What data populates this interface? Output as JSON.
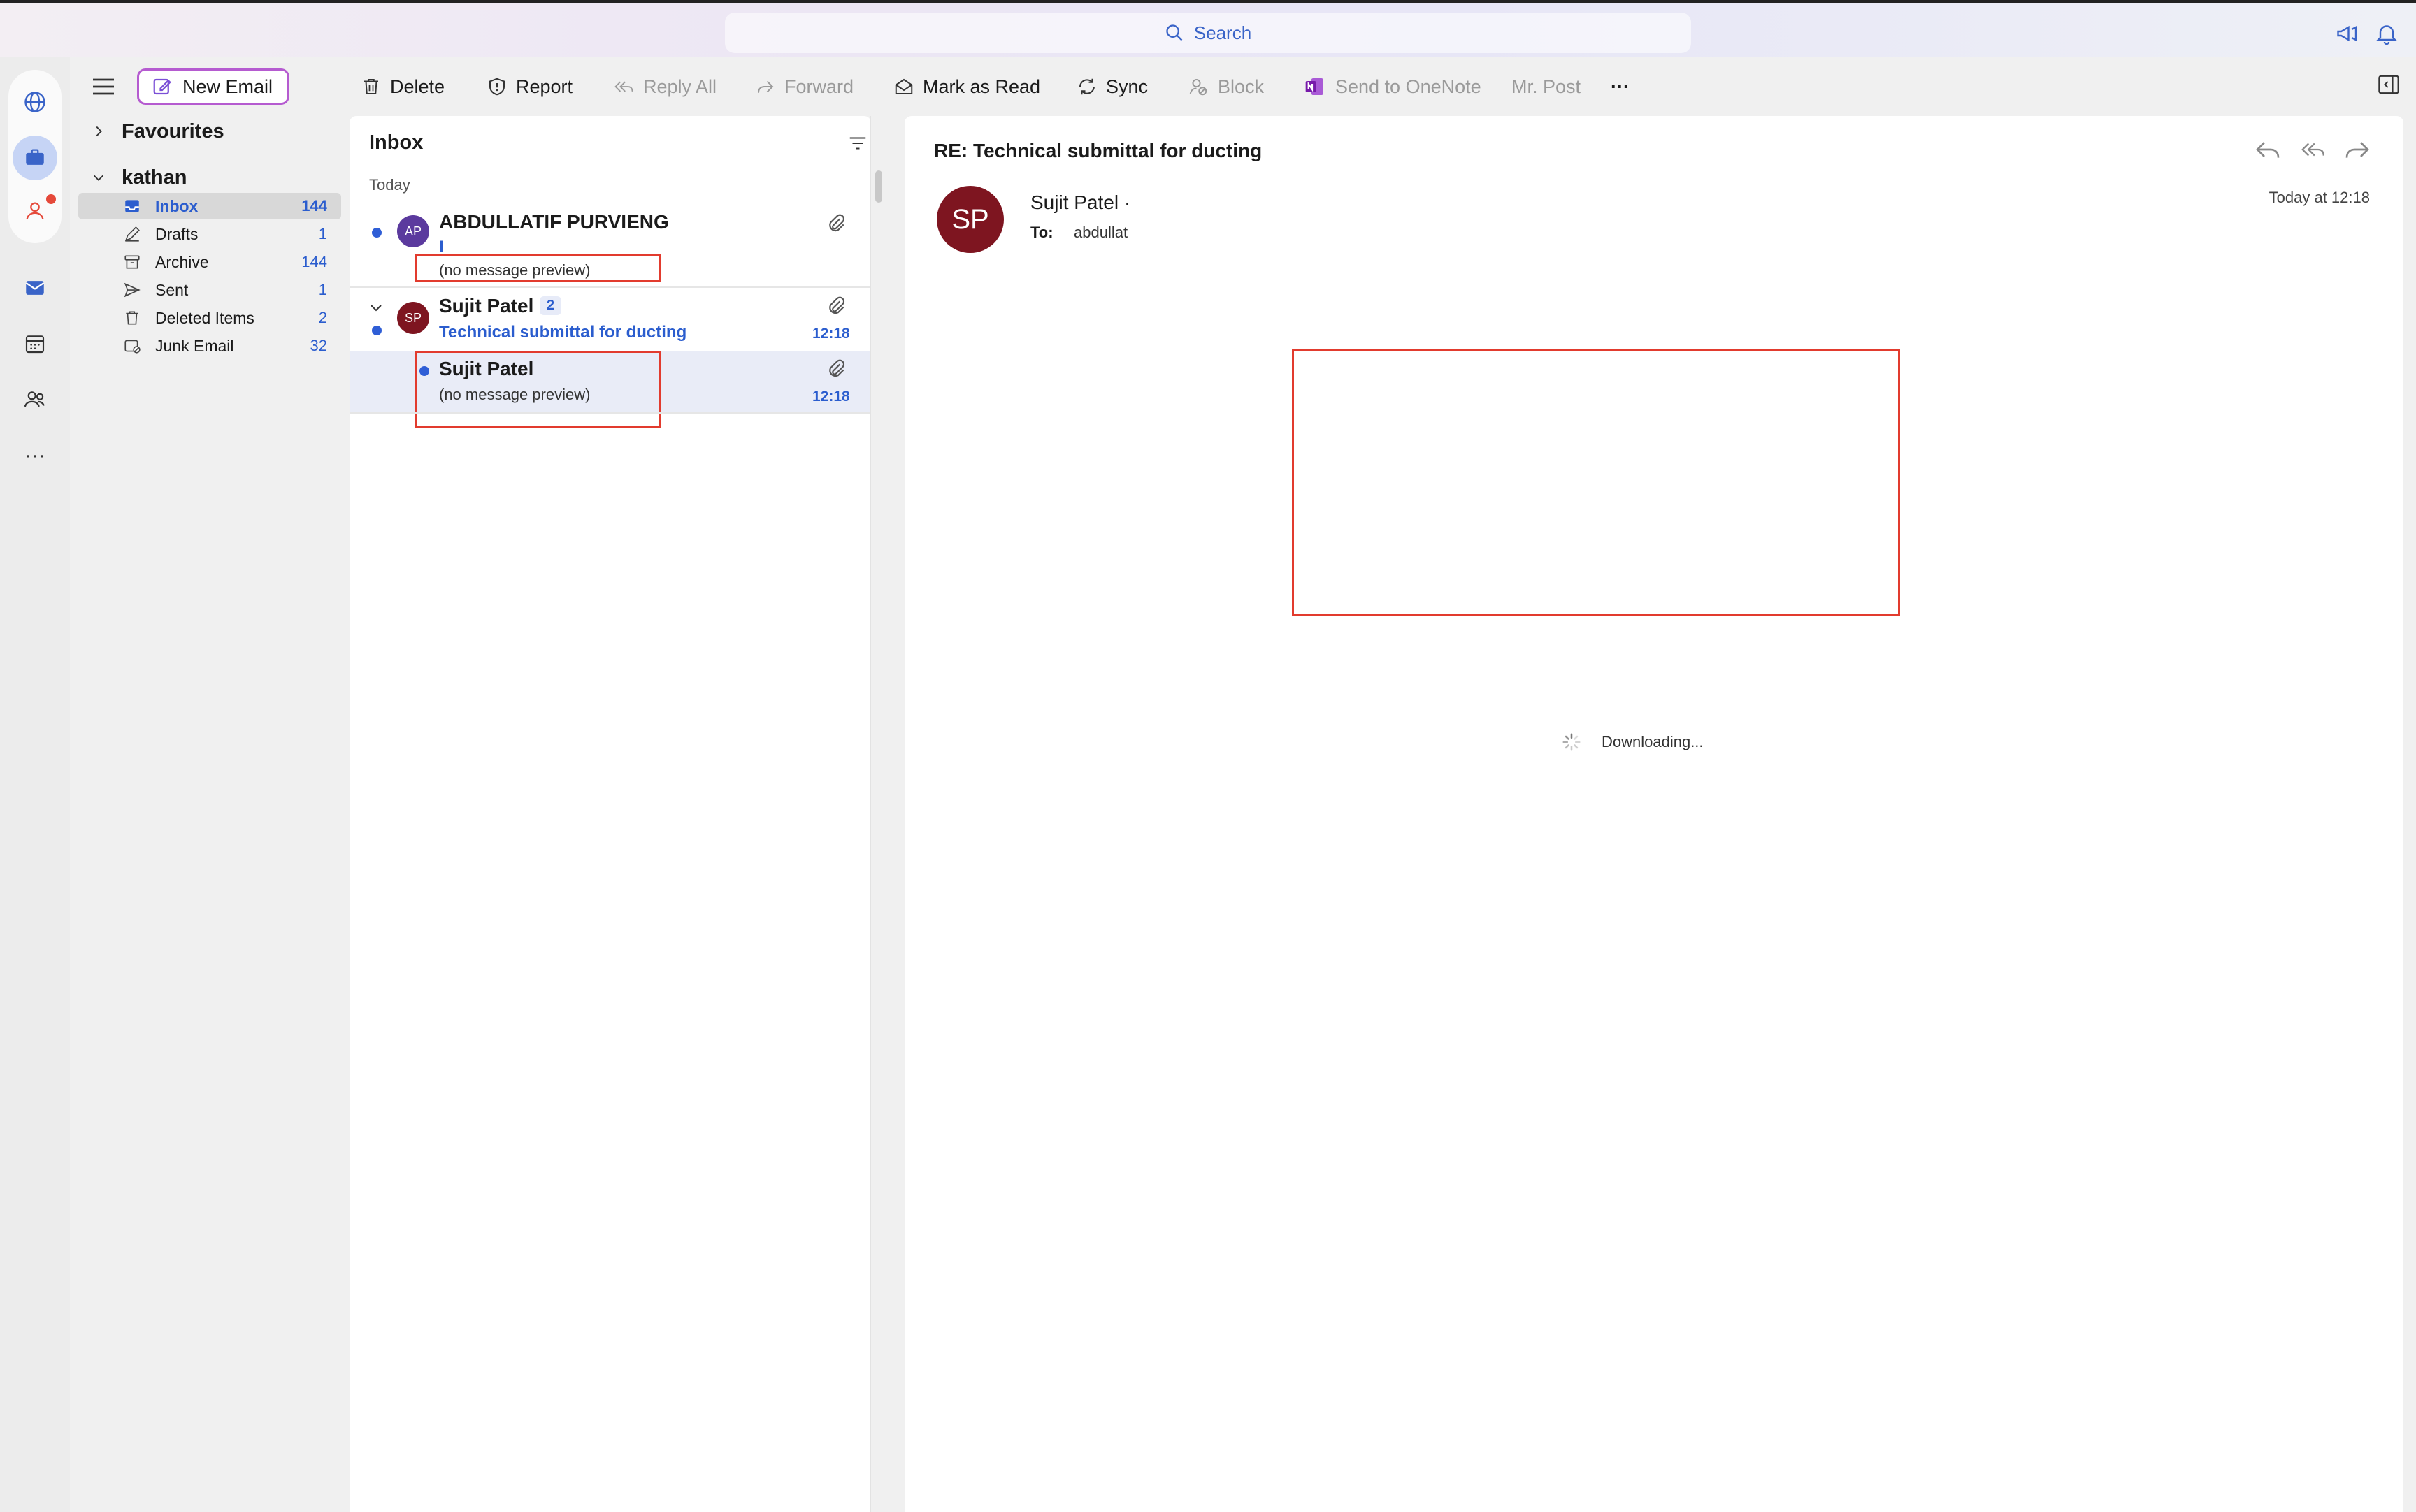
{
  "search": {
    "label": "Search"
  },
  "toolbar": {
    "new_email": "New Email",
    "delete": "Delete",
    "report": "Report",
    "reply_all": "Reply All",
    "forward": "Forward",
    "mark_as_read": "Mark as Read",
    "sync": "Sync",
    "block": "Block",
    "send_to_onenote": "Send to OneNote",
    "mr_post": "Mr. Post",
    "more": "···"
  },
  "folders": {
    "favourites": "Favourites",
    "account": "kathan",
    "items": [
      {
        "label": "Inbox",
        "count": "144",
        "icon": "inbox-icon",
        "active": true
      },
      {
        "label": "Drafts",
        "count": "1",
        "icon": "drafts-icon"
      },
      {
        "label": "Archive",
        "count": "144",
        "icon": "archive-icon"
      },
      {
        "label": "Sent",
        "count": "1",
        "icon": "sent-icon"
      },
      {
        "label": "Deleted Items",
        "count": "2",
        "icon": "trash-icon"
      },
      {
        "label": "Junk Email",
        "count": "32",
        "icon": "junk-icon"
      }
    ]
  },
  "list": {
    "title": "Inbox",
    "group": "Today",
    "messages": [
      {
        "initials": "AP",
        "sender": "ABDULLATIF PURVIENG",
        "subject": "I",
        "preview": "(no message preview)",
        "time": "",
        "avatar_color": "#5b3a9e"
      },
      {
        "initials": "SP",
        "sender": "Sujit Patel",
        "thread_count": "2",
        "subject": "Technical submittal for ducting",
        "time": "12:18",
        "avatar_color": "#7e1520"
      },
      {
        "sender": "Sujit Patel",
        "preview": "(no message preview)",
        "time": "12:18"
      }
    ]
  },
  "reading": {
    "subject": "RE: Technical submittal for ducting",
    "avatar_initials": "SP",
    "from": "Sujit Patel ·",
    "to_label": "To:",
    "to_value": "abdullat",
    "date": "Today at 12:18",
    "status": "Downloading..."
  },
  "colors": {
    "accent": "#2b5dce",
    "highlight_box": "#e23b2e",
    "new_email_border": "#b55bd0"
  }
}
